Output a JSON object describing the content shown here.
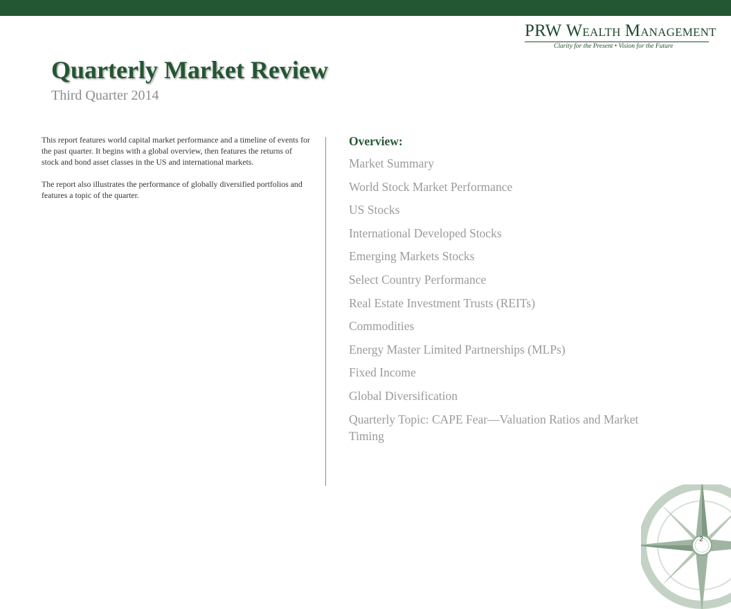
{
  "brand": {
    "name_initials": "PRW",
    "name_first": "W",
    "name_first_rest": "EALTH",
    "name_second": "M",
    "name_second_rest": "ANAGEMENT",
    "tagline": "Clarity for the Present  •  Vision for the Future",
    "color": "#235632"
  },
  "header": {
    "title": "Quarterly Market Review",
    "subtitle": "Third Quarter 2014"
  },
  "intro": {
    "paragraph1": "This report features world capital market performance and a timeline of events for the past quarter. It begins with a global overview, then features the returns of stock and bond asset classes in the US and international markets.",
    "paragraph2": "The report also illustrates the performance of globally diversified portfolios and features a topic of the quarter."
  },
  "overview": {
    "heading": "Overview:",
    "items": [
      "Market Summary",
      "World Stock Market Performance",
      "US Stocks",
      "International Developed Stocks",
      "Emerging Markets Stocks",
      "Select Country Performance",
      "Real Estate Investment Trusts (REITs)",
      "Commodities",
      "Energy Master Limited Partnerships (MLPs)",
      "Fixed Income",
      "Global Diversification",
      "Quarterly Topic: CAPE Fear—Valuation Ratios and Market Timing"
    ]
  },
  "footer": {
    "page_number": "2",
    "decoration_icon": "compass-rose-icon"
  }
}
